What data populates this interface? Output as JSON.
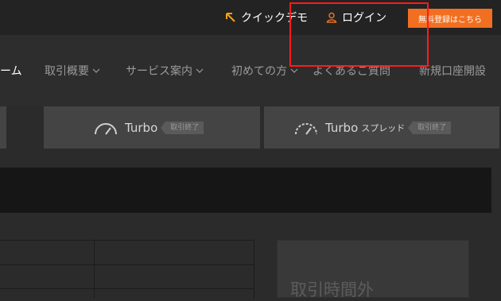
{
  "header": {
    "quick_demo_label": "クイックデモ",
    "login_label": "ログイン",
    "signup_label": "無料登録はこちら"
  },
  "nav": {
    "items": [
      {
        "label": "ーム",
        "dropdown": false,
        "active": true
      },
      {
        "label": "取引概要",
        "dropdown": true
      },
      {
        "label": "サービス案内",
        "dropdown": true
      },
      {
        "label": "初めての方",
        "dropdown": true
      },
      {
        "label": "よくあるご質問",
        "dropdown": false
      },
      {
        "label": "新規口座開設",
        "dropdown": false
      }
    ]
  },
  "products": [
    {
      "label": "Turbo",
      "sub": "",
      "status": "取引終了"
    },
    {
      "label": "Turbo",
      "sub": "スプレッド",
      "status": "取引終了"
    }
  ],
  "panel": {
    "title": "取引時間外"
  },
  "colors": {
    "accent": "#f26f21",
    "annotation": "#ff1a1a",
    "background": "#2b2b2b"
  }
}
